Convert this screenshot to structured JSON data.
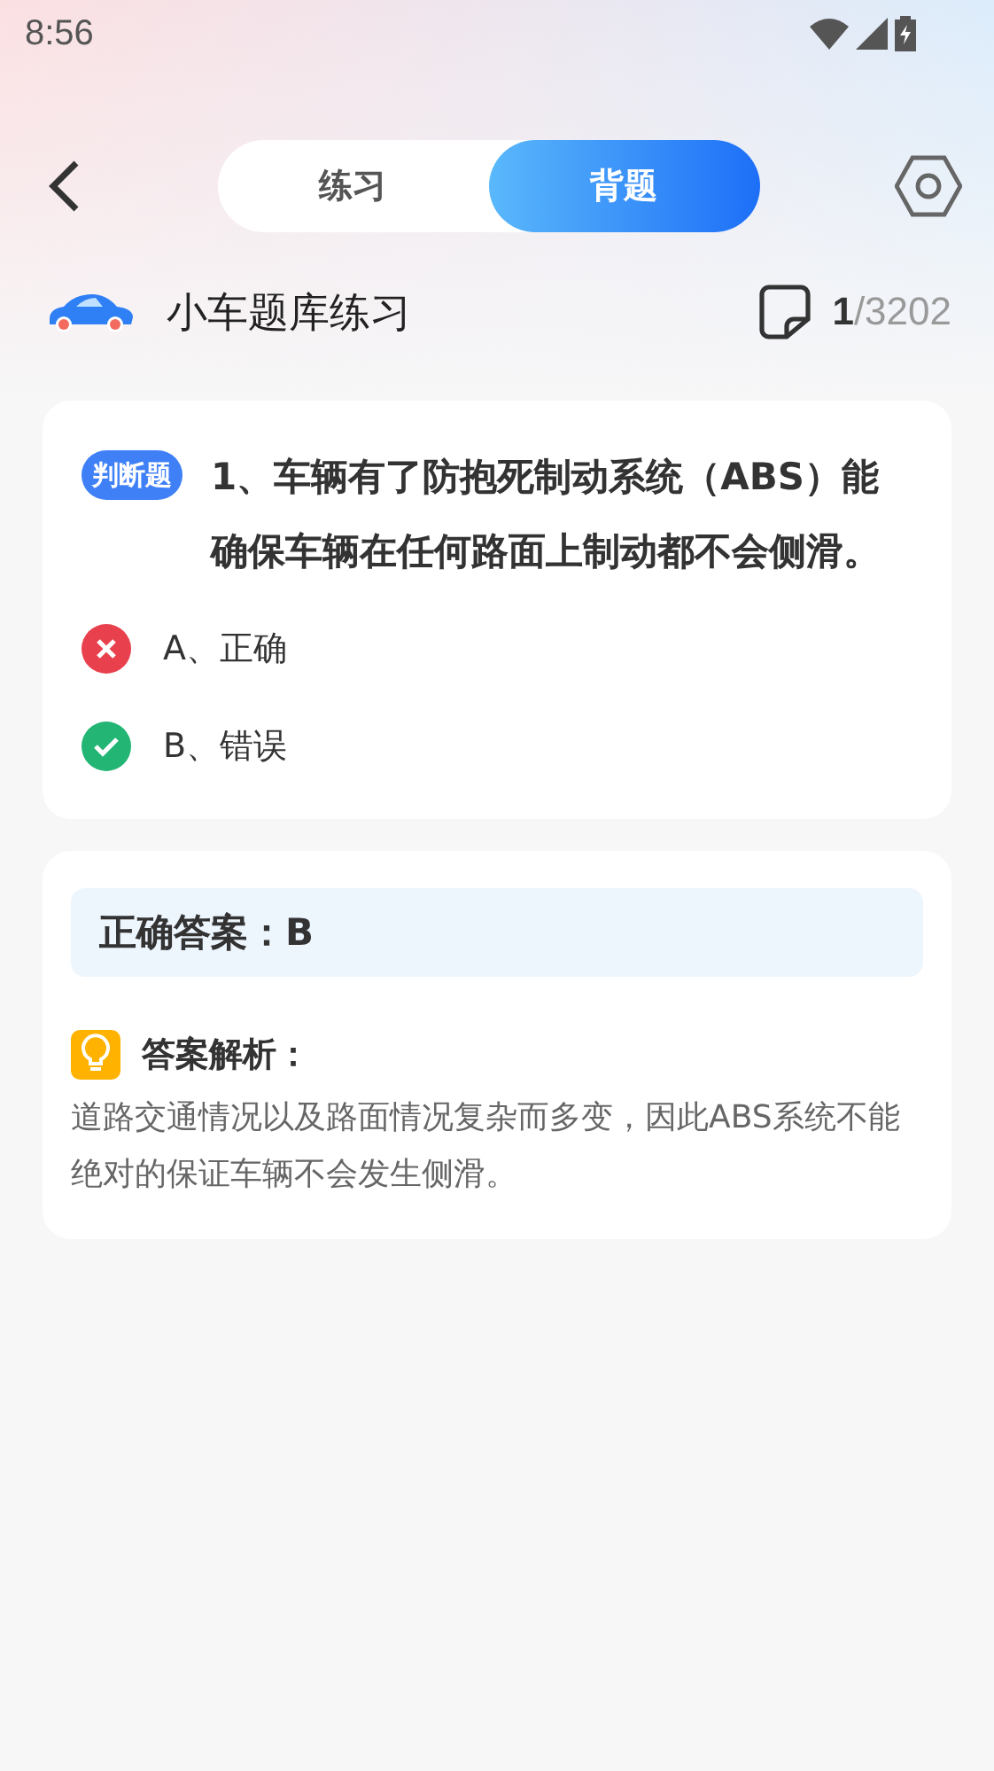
{
  "status_bar": {
    "time": "8:56"
  },
  "header": {
    "tabs": [
      {
        "label": "练习",
        "selected": false
      },
      {
        "label": "背题",
        "selected": true
      }
    ]
  },
  "course": {
    "title": "小车题库练习",
    "current": "1",
    "total": "/3202"
  },
  "question": {
    "type_badge": "判断题",
    "text": "1、车辆有了防抱死制动系统（ABS）能确保车辆在任何路面上制动都不会侧滑。",
    "options": [
      {
        "label": "A、正确",
        "correct": false
      },
      {
        "label": "B、错误",
        "correct": true
      }
    ]
  },
  "answer": {
    "correct_answer": "正确答案：B",
    "analysis_title": "答案解析：",
    "analysis_text": "道路交通情况以及路面情况复杂而多变，因此ABS系统不能绝对的保证车辆不会发生侧滑。"
  }
}
